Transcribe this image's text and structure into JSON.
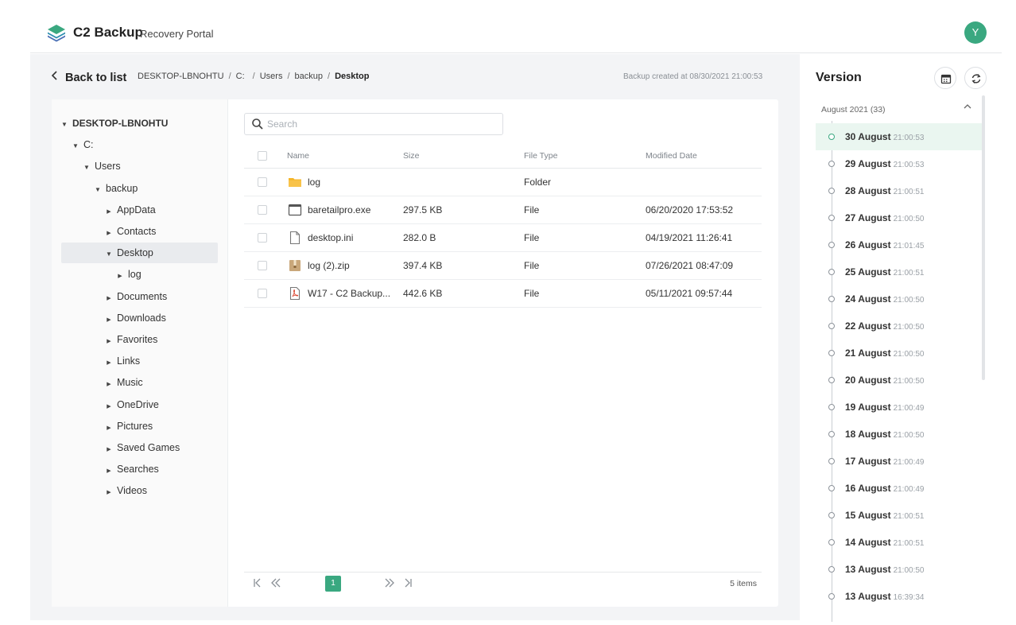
{
  "header": {
    "brand": "C2 Backup",
    "brand_sub": "Recovery Portal",
    "avatar_initial": "Y",
    "accent": "#3aa880"
  },
  "nav": {
    "back_label": "Back to list",
    "breadcrumb": [
      "DESKTOP-LBNOHTU",
      "C:",
      "Users",
      "backup",
      "Desktop"
    ],
    "created": "Backup created at 08/30/2021 21:00:53"
  },
  "tree": [
    {
      "label": "DESKTOP-LBNOHTU",
      "expanded": true
    },
    {
      "label": "C:",
      "expanded": true
    },
    {
      "label": "Users",
      "expanded": true
    },
    {
      "label": "backup",
      "expanded": true
    },
    {
      "label": "AppData",
      "expanded": false
    },
    {
      "label": "Contacts",
      "expanded": false
    },
    {
      "label": "Desktop",
      "expanded": true,
      "selected": true
    },
    {
      "label": "log",
      "expanded": false
    },
    {
      "label": "Documents",
      "expanded": false
    },
    {
      "label": "Downloads",
      "expanded": false
    },
    {
      "label": "Favorites",
      "expanded": false
    },
    {
      "label": "Links",
      "expanded": false
    },
    {
      "label": "Music",
      "expanded": false
    },
    {
      "label": "OneDrive",
      "expanded": false
    },
    {
      "label": "Pictures",
      "expanded": false
    },
    {
      "label": "Saved Games",
      "expanded": false
    },
    {
      "label": "Searches",
      "expanded": false
    },
    {
      "label": "Videos",
      "expanded": false
    }
  ],
  "search": {
    "placeholder": "Search",
    "value": ""
  },
  "table": {
    "columns": [
      "Name",
      "Size",
      "File Type",
      "Modified Date"
    ],
    "rows": [
      {
        "icon": "folder-icon",
        "name": "log",
        "size": "",
        "type": "Folder",
        "modified": ""
      },
      {
        "icon": "exe-file-icon",
        "name": "baretailpro.exe",
        "size": "297.5 KB",
        "type": "File",
        "modified": "06/20/2020 17:53:52"
      },
      {
        "icon": "file-icon",
        "name": "desktop.ini",
        "size": "282.0 B",
        "type": "File",
        "modified": "04/19/2021 11:26:41"
      },
      {
        "icon": "zip-file-icon",
        "name": "log (2).zip",
        "size": "397.4 KB",
        "type": "File",
        "modified": "07/26/2021 08:47:09"
      },
      {
        "icon": "pdf-file-icon",
        "name": "W17 - C2 Backup...",
        "size": "442.6 KB",
        "type": "File",
        "modified": "05/11/2021 09:57:44"
      }
    ]
  },
  "pager": {
    "current_page": "1",
    "items": "5 items"
  },
  "version": {
    "title": "Version",
    "group": "August 2021 (33)",
    "items": [
      {
        "date": "30 August",
        "time": "21:00:53",
        "active": true
      },
      {
        "date": "29 August",
        "time": "21:00:53"
      },
      {
        "date": "28 August",
        "time": "21:00:51"
      },
      {
        "date": "27 August",
        "time": "21:00:50"
      },
      {
        "date": "26 August",
        "time": "21:01:45"
      },
      {
        "date": "25 August",
        "time": "21:00:51"
      },
      {
        "date": "24 August",
        "time": "21:00:50"
      },
      {
        "date": "22 August",
        "time": "21:00:50"
      },
      {
        "date": "21 August",
        "time": "21:00:50"
      },
      {
        "date": "20 August",
        "time": "21:00:50"
      },
      {
        "date": "19 August",
        "time": "21:00:49"
      },
      {
        "date": "18 August",
        "time": "21:00:50"
      },
      {
        "date": "17 August",
        "time": "21:00:49"
      },
      {
        "date": "16 August",
        "time": "21:00:49"
      },
      {
        "date": "15 August",
        "time": "21:00:51"
      },
      {
        "date": "14 August",
        "time": "21:00:51"
      },
      {
        "date": "13 August",
        "time": "21:00:50"
      },
      {
        "date": "13 August",
        "time": "16:39:34"
      }
    ]
  }
}
